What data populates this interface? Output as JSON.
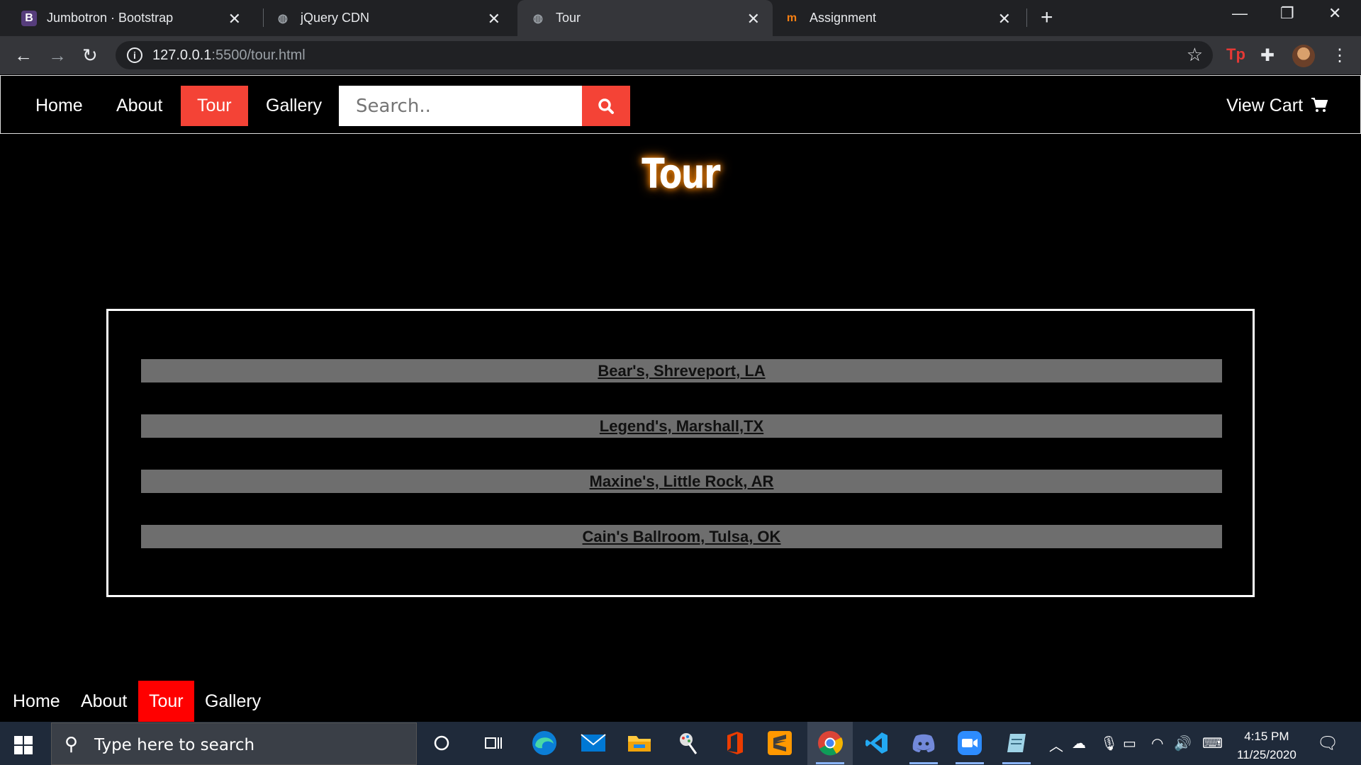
{
  "browser": {
    "tabs": [
      {
        "title": "Jumbotron · Bootstrap",
        "favicon": "bootstrap-icon"
      },
      {
        "title": "jQuery CDN",
        "favicon": "globe-icon"
      },
      {
        "title": "Tour",
        "favicon": "globe-icon"
      },
      {
        "title": "Assignment",
        "favicon": "moodle-icon"
      }
    ],
    "url_host": "127.0.0.1",
    "url_path": ":5500/tour.html"
  },
  "nav": {
    "home": "Home",
    "about": "About",
    "tour": "Tour",
    "gallery": "Gallery",
    "search_placeholder": "Search..",
    "cart": "View Cart"
  },
  "page": {
    "title": "Tour",
    "tour_dates": [
      "Bear's, Shreveport, LA",
      "Legend's, Marshall,TX",
      "Maxine's, Little Rock, AR",
      "Cain's Ballroom, Tulsa, OK"
    ]
  },
  "footer": {
    "home": "Home",
    "about": "About",
    "tour": "Tour",
    "gallery": "Gallery"
  },
  "taskbar": {
    "search_placeholder": "Type here to search",
    "time": "4:15 PM",
    "date": "11/25/2020"
  },
  "colors": {
    "accent": "#f44336",
    "footer_active": "#ff0000",
    "tour_item_bg": "#6e6e6e"
  }
}
